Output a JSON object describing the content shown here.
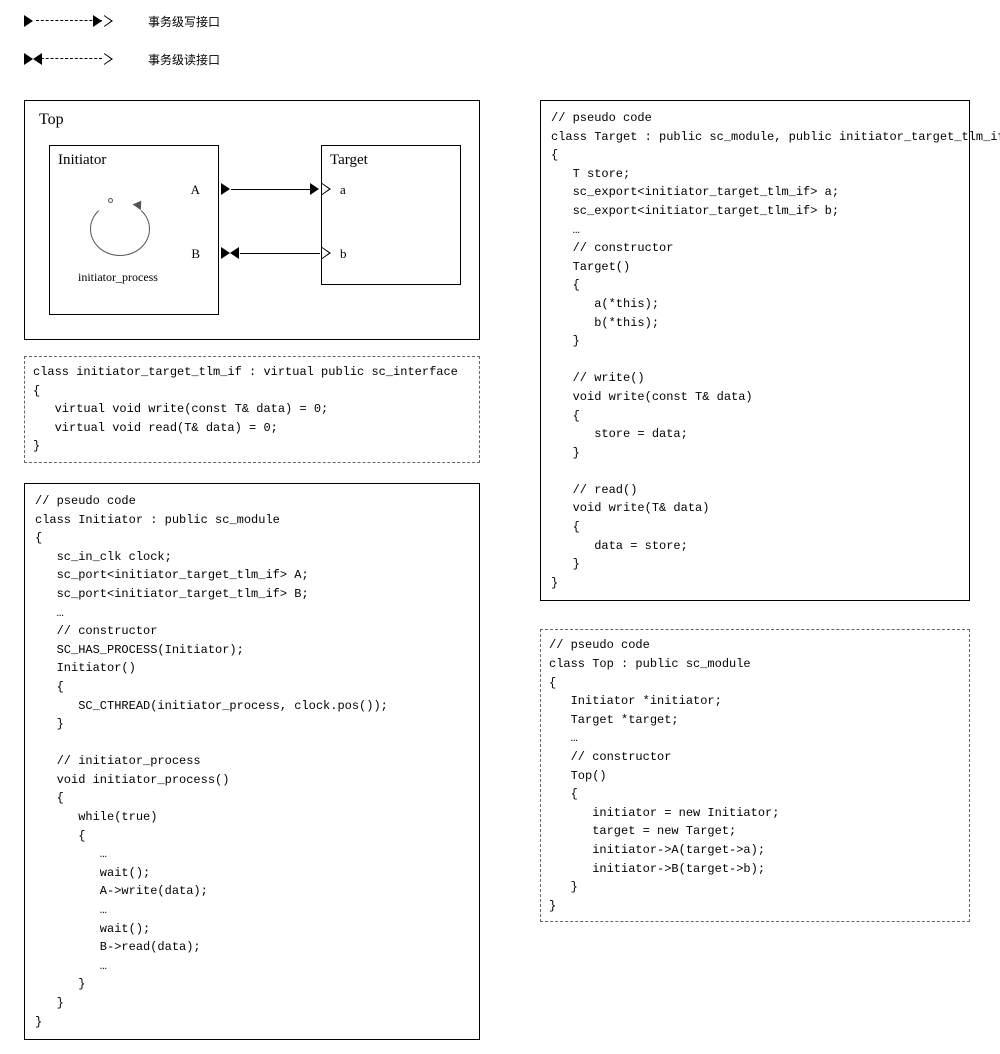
{
  "legend": {
    "write": "事务级写接口",
    "read": "事务级读接口"
  },
  "top": {
    "title": "Top",
    "initiator": {
      "title": "Initiator",
      "process": "initiator_process",
      "portA": "A",
      "portB": "B"
    },
    "target": {
      "title": "Target",
      "porta": "a",
      "portb": "b"
    }
  },
  "code": {
    "interface": "class initiator_target_tlm_if : virtual public sc_interface\n{\n   virtual void write(const T& data) = 0;\n   virtual void read(T& data) = 0;\n}",
    "initiator": "// pseudo code\nclass Initiator : public sc_module\n{\n   sc_in_clk clock;\n   sc_port<initiator_target_tlm_if> A;\n   sc_port<initiator_target_tlm_if> B;\n   …\n   // constructor\n   SC_HAS_PROCESS(Initiator);\n   Initiator()\n   {\n      SC_CTHREAD(initiator_process, clock.pos());\n   }\n\n   // initiator_process\n   void initiator_process()\n   {\n      while(true)\n      {\n         …\n         wait();\n         A->write(data);\n         …\n         wait();\n         B->read(data);\n         …\n      }\n   }\n}",
    "target": "// pseudo code\nclass Target : public sc_module, public initiator_target_tlm_if\n{\n   T store;\n   sc_export<initiator_target_tlm_if> a;\n   sc_export<initiator_target_tlm_if> b;\n   …\n   // constructor\n   Target()\n   {\n      a(*this);\n      b(*this);\n   }\n\n   // write()\n   void write(const T& data)\n   {\n      store = data;\n   }\n\n   // read()\n   void write(T& data)\n   {\n      data = store;\n   }\n}",
    "topclass": "// pseudo code\nclass Top : public sc_module\n{\n   Initiator *initiator;\n   Target *target;\n   …\n   // constructor\n   Top()\n   {\n      initiator = new Initiator;\n      target = new Target;\n      initiator->A(target->a);\n      initiator->B(target->b);\n   }\n}"
  }
}
